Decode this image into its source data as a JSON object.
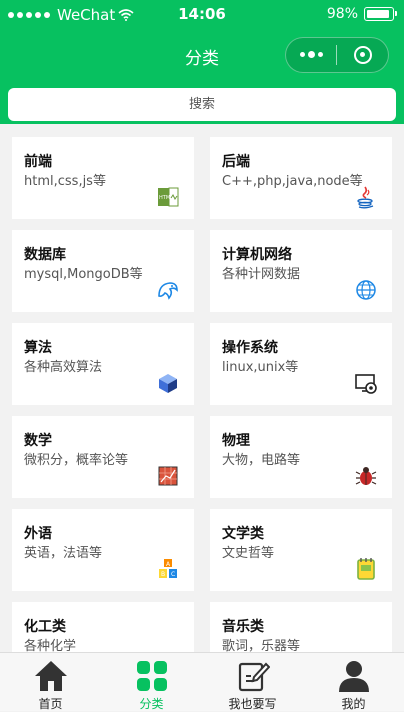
{
  "status_bar": {
    "carrier": "WeChat",
    "time": "14:06",
    "battery": "98%",
    "battery_level": 0.98
  },
  "nav": {
    "title": "分类"
  },
  "search": {
    "label": "搜索"
  },
  "categories": [
    {
      "title": "前端",
      "desc": "html,css,js等",
      "icon": "html-file-icon"
    },
    {
      "title": "后端",
      "desc": "C++,php,java,node等",
      "icon": "java-icon"
    },
    {
      "title": "数据库",
      "desc": "mysql,MongoDB等",
      "icon": "dolphin-icon"
    },
    {
      "title": "计算机网络",
      "desc": "各种计网数据",
      "icon": "globe-icon"
    },
    {
      "title": "算法",
      "desc": "各种高效算法",
      "icon": "cube-icon"
    },
    {
      "title": "操作系统",
      "desc": "linux,unix等",
      "icon": "monitor-gear-icon"
    },
    {
      "title": "数学",
      "desc": "微积分，概率论等",
      "icon": "graph-paper-icon"
    },
    {
      "title": "物理",
      "desc": "大物，电路等",
      "icon": "beetle-icon"
    },
    {
      "title": "外语",
      "desc": "英语，法语等",
      "icon": "abc-blocks-icon"
    },
    {
      "title": "文学类",
      "desc": "文史哲等",
      "icon": "notebook-icon"
    },
    {
      "title": "化工类",
      "desc": "各种化学",
      "icon": "flask-icon"
    },
    {
      "title": "音乐类",
      "desc": "歌词，乐器等",
      "icon": "music-icon"
    }
  ],
  "tabbar": {
    "items": [
      {
        "label": "首页",
        "icon": "home-icon",
        "active": false
      },
      {
        "label": "分类",
        "icon": "category-icon",
        "active": true
      },
      {
        "label": "我也要写",
        "icon": "write-icon",
        "active": false
      },
      {
        "label": "我的",
        "icon": "user-icon",
        "active": false
      }
    ]
  },
  "colors": {
    "brand": "#07c160",
    "background": "#f2f2f2"
  }
}
